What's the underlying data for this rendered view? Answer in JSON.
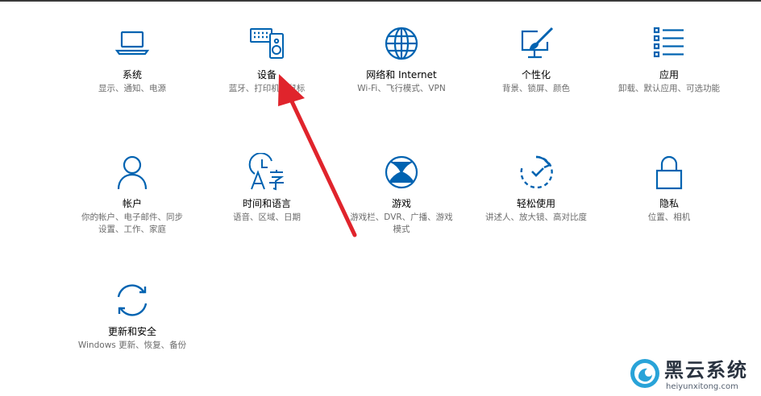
{
  "theme": {
    "accent": "#0063b1",
    "arrow": "#e0242c",
    "watermark_blue": "#29a3d8"
  },
  "tiles": [
    {
      "id": "system",
      "icon": "laptop-icon",
      "title": "系统",
      "desc": "显示、通知、电源"
    },
    {
      "id": "devices",
      "icon": "keyboard-speaker-icon",
      "title": "设备",
      "desc": "蓝牙、打印机、鼠标"
    },
    {
      "id": "network",
      "icon": "globe-icon",
      "title": "网络和 Internet",
      "desc": "Wi-Fi、飞行模式、VPN"
    },
    {
      "id": "personalization",
      "icon": "paintbrush-monitor-icon",
      "title": "个性化",
      "desc": "背景、锁屏、颜色"
    },
    {
      "id": "apps",
      "icon": "app-list-icon",
      "title": "应用",
      "desc": "卸载、默认应用、可选功能"
    },
    {
      "id": "accounts",
      "icon": "person-icon",
      "title": "帐户",
      "desc": "你的帐户、电子邮件、同步设置、工作、家庭"
    },
    {
      "id": "time-language",
      "icon": "time-language-icon",
      "title": "时间和语言",
      "desc": "语音、区域、日期"
    },
    {
      "id": "gaming",
      "icon": "xbox-icon",
      "title": "游戏",
      "desc": "游戏栏、DVR、广播、游戏模式"
    },
    {
      "id": "ease-of-access",
      "icon": "ease-of-access-icon",
      "title": "轻松使用",
      "desc": "讲述人、放大镜、高对比度"
    },
    {
      "id": "privacy",
      "icon": "lock-icon",
      "title": "隐私",
      "desc": "位置、相机"
    },
    {
      "id": "update-security",
      "icon": "sync-arrows-icon",
      "title": "更新和安全",
      "desc": "Windows 更新、恢复、备份"
    }
  ],
  "watermark": {
    "title": "黑云系统",
    "url": "heiyunxitong.com"
  }
}
